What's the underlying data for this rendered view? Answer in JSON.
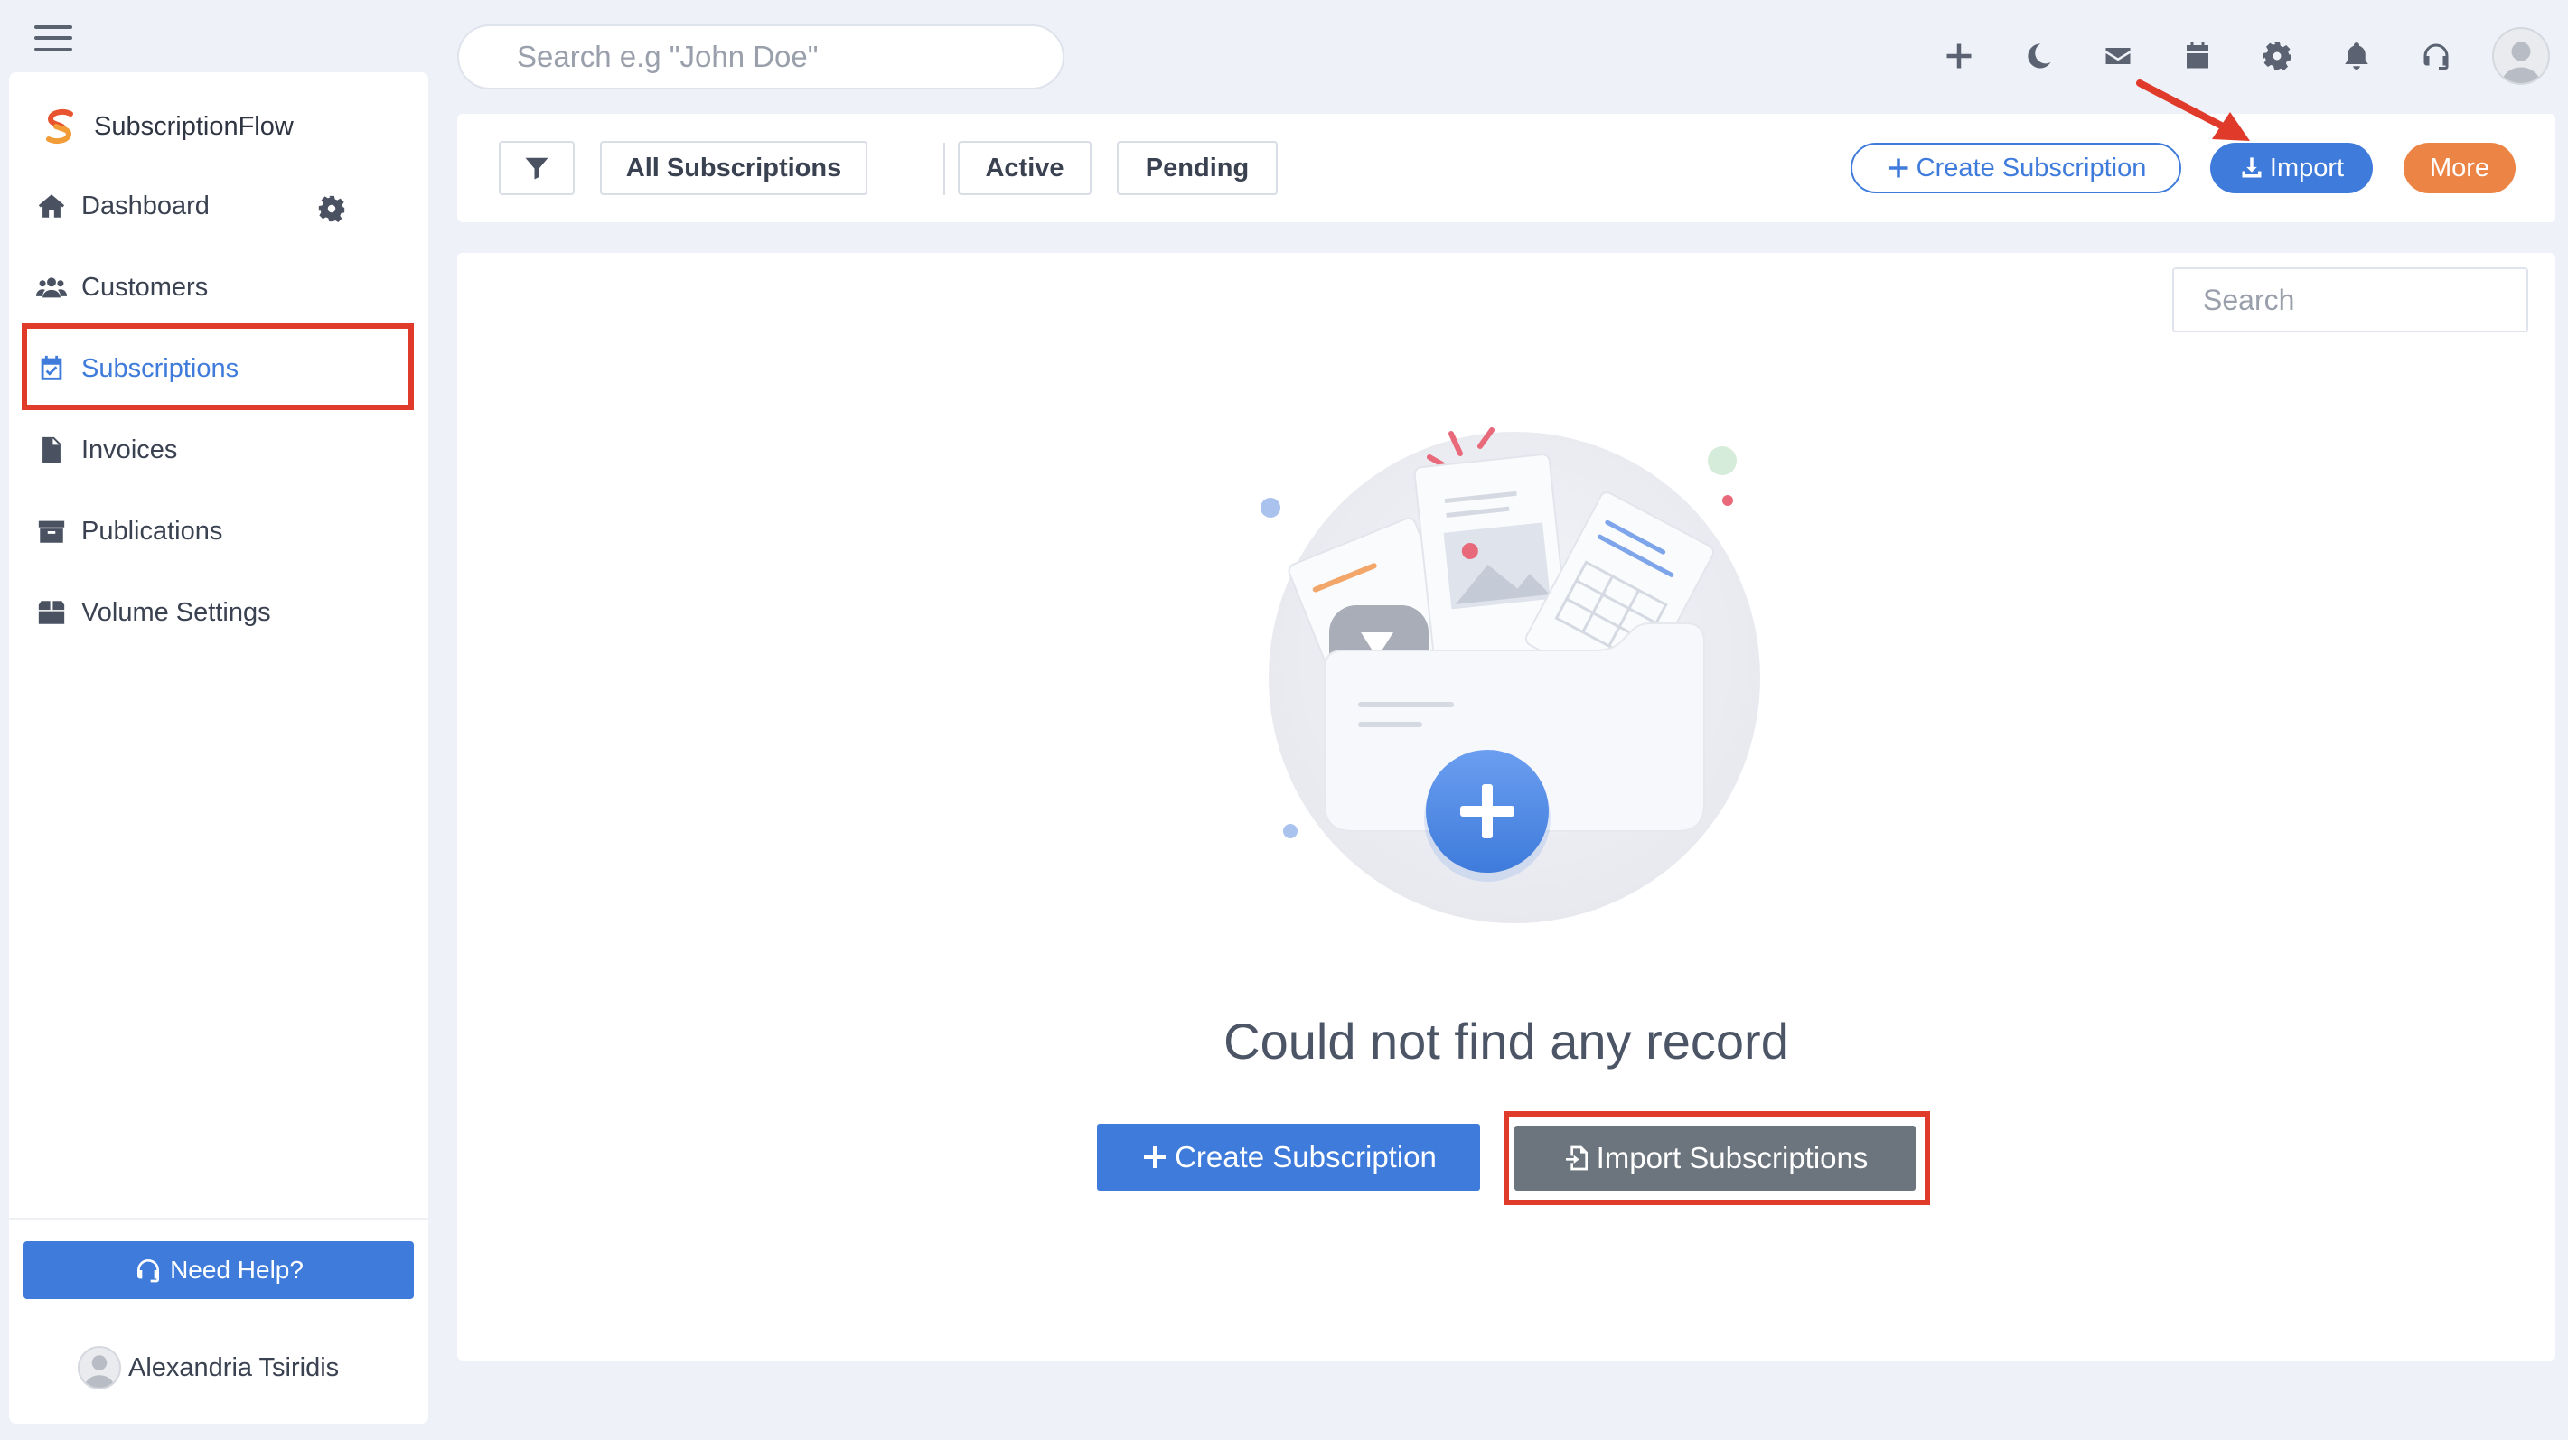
{
  "header": {
    "search_placeholder": "Search e.g \"John Doe\"",
    "icons": [
      "plus-icon",
      "moon-icon",
      "envelope-icon",
      "calendar-icon",
      "gear-icon",
      "bell-icon",
      "headset-icon",
      "user-avatar"
    ]
  },
  "sidebar": {
    "brand": "SubscriptionFlow",
    "items": [
      {
        "label": "Dashboard",
        "icon": "home-icon"
      },
      {
        "label": "Customers",
        "icon": "users-icon"
      },
      {
        "label": "Subscriptions",
        "icon": "calendar-check-icon",
        "active": true
      },
      {
        "label": "Invoices",
        "icon": "invoice-icon"
      },
      {
        "label": "Publications",
        "icon": "archive-icon"
      },
      {
        "label": "Volume Settings",
        "icon": "box-icon"
      }
    ],
    "need_help": "Need Help?",
    "user_name": "Alexandria Tsiridis"
  },
  "toolbar": {
    "filters": [
      "All Subscriptions",
      "Active",
      "Pending"
    ],
    "create_label": "Create Subscription",
    "import_label": "Import",
    "more_label": "More"
  },
  "main": {
    "search_placeholder": "Search",
    "empty_message": "Could not find any record",
    "create_button": "Create Subscription",
    "import_button": "Import Subscriptions"
  },
  "colors": {
    "accent": "#3e7bdb",
    "orange": "#ec8446",
    "gray_button": "#6c757d",
    "highlight": "#e03a2b",
    "background": "#eef1f8"
  }
}
